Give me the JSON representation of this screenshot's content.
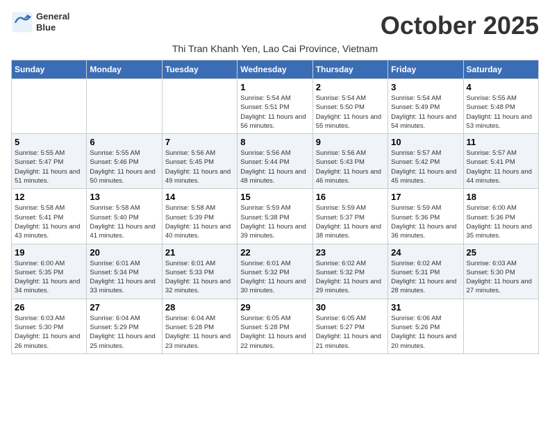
{
  "logo": {
    "line1": "General",
    "line2": "Blue"
  },
  "title": "October 2025",
  "subtitle": "Thi Tran Khanh Yen, Lao Cai Province, Vietnam",
  "weekdays": [
    "Sunday",
    "Monday",
    "Tuesday",
    "Wednesday",
    "Thursday",
    "Friday",
    "Saturday"
  ],
  "weeks": [
    [
      {
        "day": "",
        "info": ""
      },
      {
        "day": "",
        "info": ""
      },
      {
        "day": "",
        "info": ""
      },
      {
        "day": "1",
        "info": "Sunrise: 5:54 AM\nSunset: 5:51 PM\nDaylight: 11 hours and 56 minutes."
      },
      {
        "day": "2",
        "info": "Sunrise: 5:54 AM\nSunset: 5:50 PM\nDaylight: 11 hours and 55 minutes."
      },
      {
        "day": "3",
        "info": "Sunrise: 5:54 AM\nSunset: 5:49 PM\nDaylight: 11 hours and 54 minutes."
      },
      {
        "day": "4",
        "info": "Sunrise: 5:55 AM\nSunset: 5:48 PM\nDaylight: 11 hours and 53 minutes."
      }
    ],
    [
      {
        "day": "5",
        "info": "Sunrise: 5:55 AM\nSunset: 5:47 PM\nDaylight: 11 hours and 51 minutes."
      },
      {
        "day": "6",
        "info": "Sunrise: 5:55 AM\nSunset: 5:46 PM\nDaylight: 11 hours and 50 minutes."
      },
      {
        "day": "7",
        "info": "Sunrise: 5:56 AM\nSunset: 5:45 PM\nDaylight: 11 hours and 49 minutes."
      },
      {
        "day": "8",
        "info": "Sunrise: 5:56 AM\nSunset: 5:44 PM\nDaylight: 11 hours and 48 minutes."
      },
      {
        "day": "9",
        "info": "Sunrise: 5:56 AM\nSunset: 5:43 PM\nDaylight: 11 hours and 46 minutes."
      },
      {
        "day": "10",
        "info": "Sunrise: 5:57 AM\nSunset: 5:42 PM\nDaylight: 11 hours and 45 minutes."
      },
      {
        "day": "11",
        "info": "Sunrise: 5:57 AM\nSunset: 5:41 PM\nDaylight: 11 hours and 44 minutes."
      }
    ],
    [
      {
        "day": "12",
        "info": "Sunrise: 5:58 AM\nSunset: 5:41 PM\nDaylight: 11 hours and 43 minutes."
      },
      {
        "day": "13",
        "info": "Sunrise: 5:58 AM\nSunset: 5:40 PM\nDaylight: 11 hours and 41 minutes."
      },
      {
        "day": "14",
        "info": "Sunrise: 5:58 AM\nSunset: 5:39 PM\nDaylight: 11 hours and 40 minutes."
      },
      {
        "day": "15",
        "info": "Sunrise: 5:59 AM\nSunset: 5:38 PM\nDaylight: 11 hours and 39 minutes."
      },
      {
        "day": "16",
        "info": "Sunrise: 5:59 AM\nSunset: 5:37 PM\nDaylight: 11 hours and 38 minutes."
      },
      {
        "day": "17",
        "info": "Sunrise: 5:59 AM\nSunset: 5:36 PM\nDaylight: 11 hours and 36 minutes."
      },
      {
        "day": "18",
        "info": "Sunrise: 6:00 AM\nSunset: 5:36 PM\nDaylight: 11 hours and 35 minutes."
      }
    ],
    [
      {
        "day": "19",
        "info": "Sunrise: 6:00 AM\nSunset: 5:35 PM\nDaylight: 11 hours and 34 minutes."
      },
      {
        "day": "20",
        "info": "Sunrise: 6:01 AM\nSunset: 5:34 PM\nDaylight: 11 hours and 33 minutes."
      },
      {
        "day": "21",
        "info": "Sunrise: 6:01 AM\nSunset: 5:33 PM\nDaylight: 11 hours and 32 minutes."
      },
      {
        "day": "22",
        "info": "Sunrise: 6:01 AM\nSunset: 5:32 PM\nDaylight: 11 hours and 30 minutes."
      },
      {
        "day": "23",
        "info": "Sunrise: 6:02 AM\nSunset: 5:32 PM\nDaylight: 11 hours and 29 minutes."
      },
      {
        "day": "24",
        "info": "Sunrise: 6:02 AM\nSunset: 5:31 PM\nDaylight: 11 hours and 28 minutes."
      },
      {
        "day": "25",
        "info": "Sunrise: 6:03 AM\nSunset: 5:30 PM\nDaylight: 11 hours and 27 minutes."
      }
    ],
    [
      {
        "day": "26",
        "info": "Sunrise: 6:03 AM\nSunset: 5:30 PM\nDaylight: 11 hours and 26 minutes."
      },
      {
        "day": "27",
        "info": "Sunrise: 6:04 AM\nSunset: 5:29 PM\nDaylight: 11 hours and 25 minutes."
      },
      {
        "day": "28",
        "info": "Sunrise: 6:04 AM\nSunset: 5:28 PM\nDaylight: 11 hours and 23 minutes."
      },
      {
        "day": "29",
        "info": "Sunrise: 6:05 AM\nSunset: 5:28 PM\nDaylight: 11 hours and 22 minutes."
      },
      {
        "day": "30",
        "info": "Sunrise: 6:05 AM\nSunset: 5:27 PM\nDaylight: 11 hours and 21 minutes."
      },
      {
        "day": "31",
        "info": "Sunrise: 6:06 AM\nSunset: 5:26 PM\nDaylight: 11 hours and 20 minutes."
      },
      {
        "day": "",
        "info": ""
      }
    ]
  ]
}
